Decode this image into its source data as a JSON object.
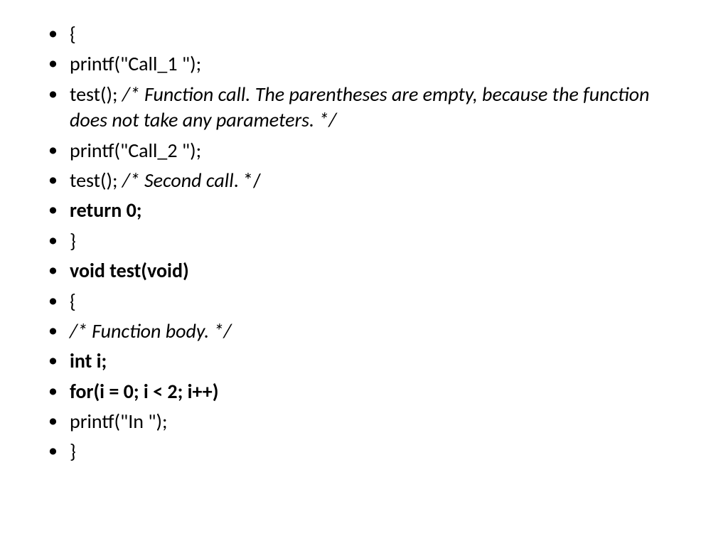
{
  "lines": [
    {
      "parts": [
        {
          "text": "{",
          "style": "regular"
        }
      ]
    },
    {
      "parts": [
        {
          "text": "printf(\"Call_1 \");",
          "style": "regular"
        }
      ]
    },
    {
      "parts": [
        {
          "text": "test(); ",
          "style": "regular"
        },
        {
          "text": "/* Function call. The parentheses are empty, because the function does not take any parameters. */",
          "style": "italic"
        }
      ]
    },
    {
      "parts": [
        {
          "text": "printf(\"Call_2 \");",
          "style": "regular"
        }
      ]
    },
    {
      "parts": [
        {
          "text": "test(); ",
          "style": "regular"
        },
        {
          "text": "/* Second call",
          "style": "italic"
        },
        {
          "text": ". */",
          "style": "regular"
        }
      ]
    },
    {
      "parts": [
        {
          "text": "return 0;",
          "style": "bold"
        }
      ]
    },
    {
      "parts": [
        {
          "text": "}",
          "style": "regular"
        }
      ]
    },
    {
      "parts": [
        {
          "text": "void test(void)",
          "style": "bold"
        }
      ]
    },
    {
      "parts": [
        {
          "text": "{",
          "style": "regular"
        }
      ]
    },
    {
      "parts": [
        {
          "text": "/* Function body. */",
          "style": "italic"
        }
      ]
    },
    {
      "parts": [
        {
          "text": "int i;",
          "style": "bold"
        }
      ]
    },
    {
      "parts": [
        {
          "text": "for(i = 0; i < 2; i++)",
          "style": "bold"
        }
      ]
    },
    {
      "parts": [
        {
          "text": "printf(\"In \");",
          "style": "regular"
        }
      ]
    },
    {
      "parts": [
        {
          "text": "}",
          "style": "regular"
        }
      ]
    }
  ]
}
